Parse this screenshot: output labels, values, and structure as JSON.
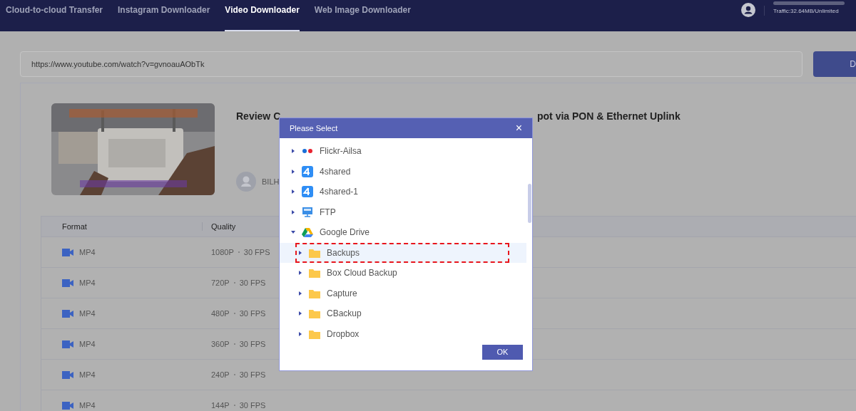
{
  "nav": {
    "tabs": [
      {
        "label": "Cloud-to-cloud Transfer",
        "selected": false
      },
      {
        "label": "Instagram Downloader",
        "selected": false
      },
      {
        "label": "Video Downloader",
        "selected": true
      },
      {
        "label": "Web Image Downloader",
        "selected": false
      }
    ],
    "traffic": "Traffic:32.64MB/Unlimited"
  },
  "url_field": {
    "value": "https://www.youtube.com/watch?v=gvnoauAObTk"
  },
  "download_button": "D",
  "video": {
    "title_start": "Review C",
    "title_end": "pot via PON & Ethernet Uplink",
    "author": "BILH"
  },
  "table": {
    "columns": [
      "Format",
      "Quality"
    ],
    "rows": [
      {
        "format": "MP4",
        "quality": "1080P",
        "fps": "30 FPS"
      },
      {
        "format": "MP4",
        "quality": "720P",
        "fps": "30 FPS"
      },
      {
        "format": "MP4",
        "quality": "480P",
        "fps": "30 FPS"
      },
      {
        "format": "MP4",
        "quality": "360P",
        "fps": "30 FPS"
      },
      {
        "format": "MP4",
        "quality": "240P",
        "fps": "30 FPS"
      },
      {
        "format": "MP4",
        "quality": "144P",
        "fps": "30 FPS"
      }
    ]
  },
  "dialog": {
    "title": "Please Select",
    "close": "×",
    "ok": "OK",
    "tree": [
      {
        "label": "Flickr-Ailsa",
        "kind": "flickr",
        "expanded": false,
        "selected": false
      },
      {
        "label": "4shared",
        "kind": "fourshared",
        "expanded": false,
        "selected": false
      },
      {
        "label": "4shared-1",
        "kind": "fourshared",
        "expanded": false,
        "selected": false
      },
      {
        "label": "FTP",
        "kind": "ftp",
        "expanded": false,
        "selected": false
      },
      {
        "label": "Google Drive",
        "kind": "gdrive",
        "expanded": true,
        "selected": false,
        "children": [
          {
            "label": "Backups",
            "kind": "folder",
            "expanded": false,
            "selected": true
          },
          {
            "label": "Box Cloud Backup",
            "kind": "folder",
            "expanded": false,
            "selected": false
          },
          {
            "label": "Capture",
            "kind": "folder",
            "expanded": false,
            "selected": false
          },
          {
            "label": "CBackup",
            "kind": "folder",
            "expanded": false,
            "selected": false
          },
          {
            "label": "Dropbox",
            "kind": "folder",
            "expanded": false,
            "selected": false
          }
        ]
      }
    ]
  }
}
